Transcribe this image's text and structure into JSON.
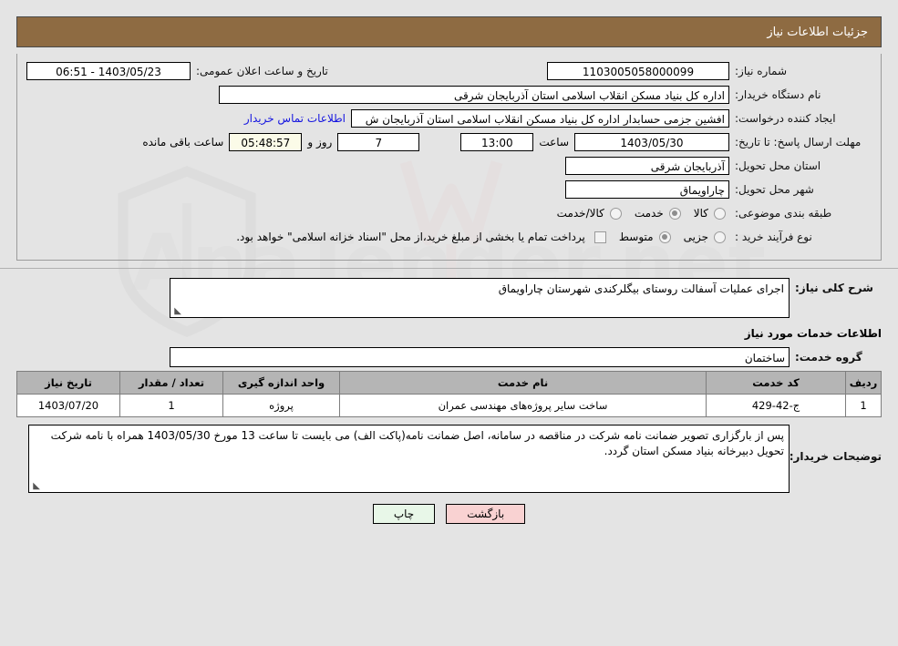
{
  "header": {
    "title": "جزئیات اطلاعات نیاز"
  },
  "form": {
    "need_number_label": "شماره نیاز:",
    "need_number_value": "1103005058000099",
    "announce_label": "تاریخ و ساعت اعلان عمومی:",
    "announce_value": "1403/05/23 - 06:51",
    "buyer_org_label": "نام دستگاه خریدار:",
    "buyer_org_value": "اداره کل بنیاد مسکن انقلاب اسلامی استان آذربایجان شرقی",
    "requester_label": "ایجاد کننده درخواست:",
    "requester_value": "افشین جزمی حسابدار اداره کل بنیاد مسکن انقلاب اسلامی استان آذربایجان ش",
    "contact_link": "اطلاعات تماس خریدار",
    "deadline_label": "مهلت ارسال پاسخ: تا تاریخ:",
    "deadline_date": "1403/05/30",
    "time_label": "ساعت",
    "deadline_time": "13:00",
    "days_value": "7",
    "days_label": "روز و",
    "countdown_value": "05:48:57",
    "countdown_label": "ساعت باقی مانده",
    "province_label": "استان محل تحویل:",
    "province_value": "آذربایجان شرقی",
    "city_label": "شهر محل تحویل:",
    "city_value": "چاراویماق",
    "category_label": "طبقه بندی موضوعی:",
    "category_options": [
      {
        "label": "کالا",
        "selected": false
      },
      {
        "label": "خدمت",
        "selected": true
      },
      {
        "label": "کالا/خدمت",
        "selected": false
      }
    ],
    "purchase_type_label": "نوع فرآیند خرید :",
    "purchase_type_options": [
      {
        "label": "جزیی",
        "selected": false
      },
      {
        "label": "متوسط",
        "selected": true
      }
    ],
    "treasury_checkbox_label": "پرداخت تمام یا بخشی از مبلغ خرید،از محل \"اسناد خزانه اسلامی\" خواهد بود.",
    "treasury_checked": false
  },
  "details": {
    "general_desc_label": "شرح کلی نیاز:",
    "general_desc_value": "اجرای عملیات آسفالت روستای بیگلرکندی شهرستان چاراویماق",
    "services_heading": "اطلاعات خدمات مورد نیاز",
    "service_group_label": "گروه خدمت:",
    "service_group_value": "ساختمان"
  },
  "table": {
    "columns": [
      "ردیف",
      "کد خدمت",
      "نام خدمت",
      "واحد اندازه گیری",
      "تعداد / مقدار",
      "تاریخ نیاز"
    ],
    "rows": [
      {
        "row_no": "1",
        "service_code": "ج-42-429",
        "service_name": "ساخت سایر پروژه‌های مهندسی عمران",
        "unit": "پروژه",
        "quantity": "1",
        "need_date": "1403/07/20"
      }
    ]
  },
  "buyer_notes": {
    "label": "توضیحات خریدار:",
    "value": "پس از بارگزاری تصویر ضمانت نامه شرکت در مناقصه در سامانه، اصل ضمانت نامه(پاکت الف) می بایست تا ساعت 13 مورخ 1403/05/30 همراه با نامه شرکت تحویل دبیرخانه بنیاد مسکن استان گردد."
  },
  "footer": {
    "print_label": "چاپ",
    "back_label": "بازگشت"
  },
  "watermark": {
    "text": "AnaTender.net"
  },
  "colors": {
    "header_bg": "#8e6b42",
    "link": "#1414e0",
    "table_header_bg": "#b5b5b5",
    "print_btn_bg": "#e8f7e8",
    "back_btn_bg": "#f9d2d2"
  }
}
